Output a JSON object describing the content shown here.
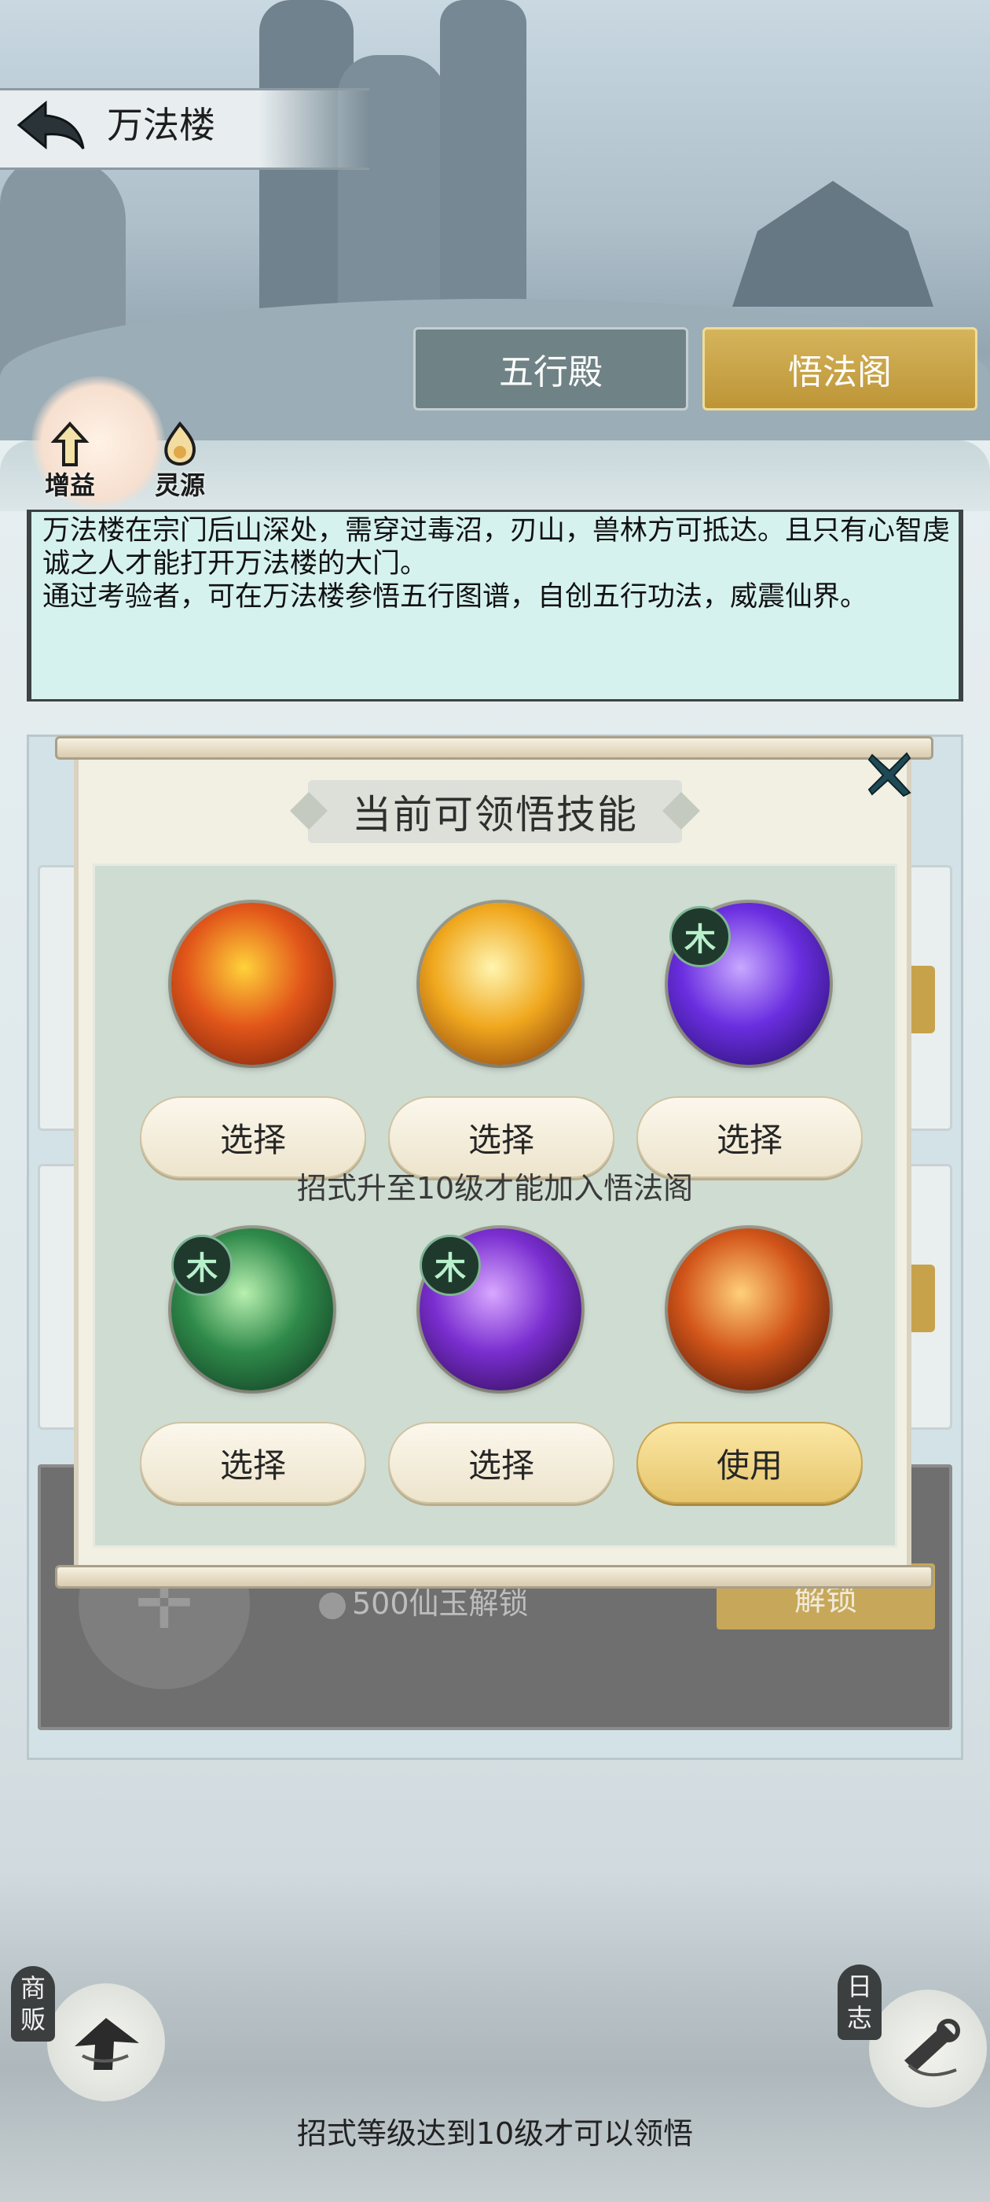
{
  "header": {
    "title": "万法楼"
  },
  "tabs": [
    {
      "label": "五行殿",
      "active": false
    },
    {
      "label": "悟法阁",
      "active": true
    }
  ],
  "side_icons": [
    {
      "label": "增益",
      "icon": "arrow-up-icon"
    },
    {
      "label": "灵源",
      "icon": "spirit-source-icon"
    }
  ],
  "description": {
    "line1": "万法楼在宗门后山深处，需穿过毒沼，刃山，兽林方可抵达。且只有心智虔诚之人才能打开万法楼的大门。",
    "line2": "通过考验者，可在万法楼参悟五行图谱，自创五行功法，威震仙界。"
  },
  "underlay": {
    "unlock_cost": "500仙玉解锁",
    "unlock_button": "解锁"
  },
  "modal": {
    "title": "当前可领悟技能",
    "hint": "招式升至10级才能加入悟法阁",
    "skills": [
      {
        "icon": "fire-fist-skill-icon",
        "badge": "",
        "button": "选择",
        "button_style": "cream",
        "colors": [
          "#ffd23a",
          "#e2561a",
          "#6a1a08"
        ]
      },
      {
        "icon": "golden-burst-skill-icon",
        "badge": "",
        "button": "选择",
        "button_style": "cream",
        "colors": [
          "#fff5b0",
          "#f0a81e",
          "#7a2d0a"
        ]
      },
      {
        "icon": "violet-phoenix-skill-icon",
        "badge": "木",
        "button": "选择",
        "button_style": "cream",
        "colors": [
          "#c8a8ff",
          "#6a2ee0",
          "#1e0b5a"
        ]
      },
      {
        "icon": "jade-swirl-skill-icon",
        "badge": "木",
        "button": "选择",
        "button_style": "cream",
        "colors": [
          "#b8f0b0",
          "#2f8a4a",
          "#0c2e1c"
        ]
      },
      {
        "icon": "meditation-vortex-skill-icon",
        "badge": "木",
        "button": "选择",
        "button_style": "cream",
        "colors": [
          "#d8a8ff",
          "#7a2ed0",
          "#22083e"
        ]
      },
      {
        "icon": "flame-dragon-skill-icon",
        "badge": "",
        "button": "使用",
        "button_style": "gold",
        "colors": [
          "#ffd07a",
          "#d2551a",
          "#3a0e04"
        ]
      }
    ]
  },
  "bottom": {
    "merchant_label": "商贩",
    "journal_label": "日志",
    "notice": "招式等级达到10级才可以领悟"
  },
  "colors": {
    "tab_active": "#c9a246",
    "tab_inactive": "#6f8286",
    "desc_bg": "#d6f2ef",
    "modal_bg": "#f2efe3",
    "modal_inner": "#cfdcd2"
  }
}
